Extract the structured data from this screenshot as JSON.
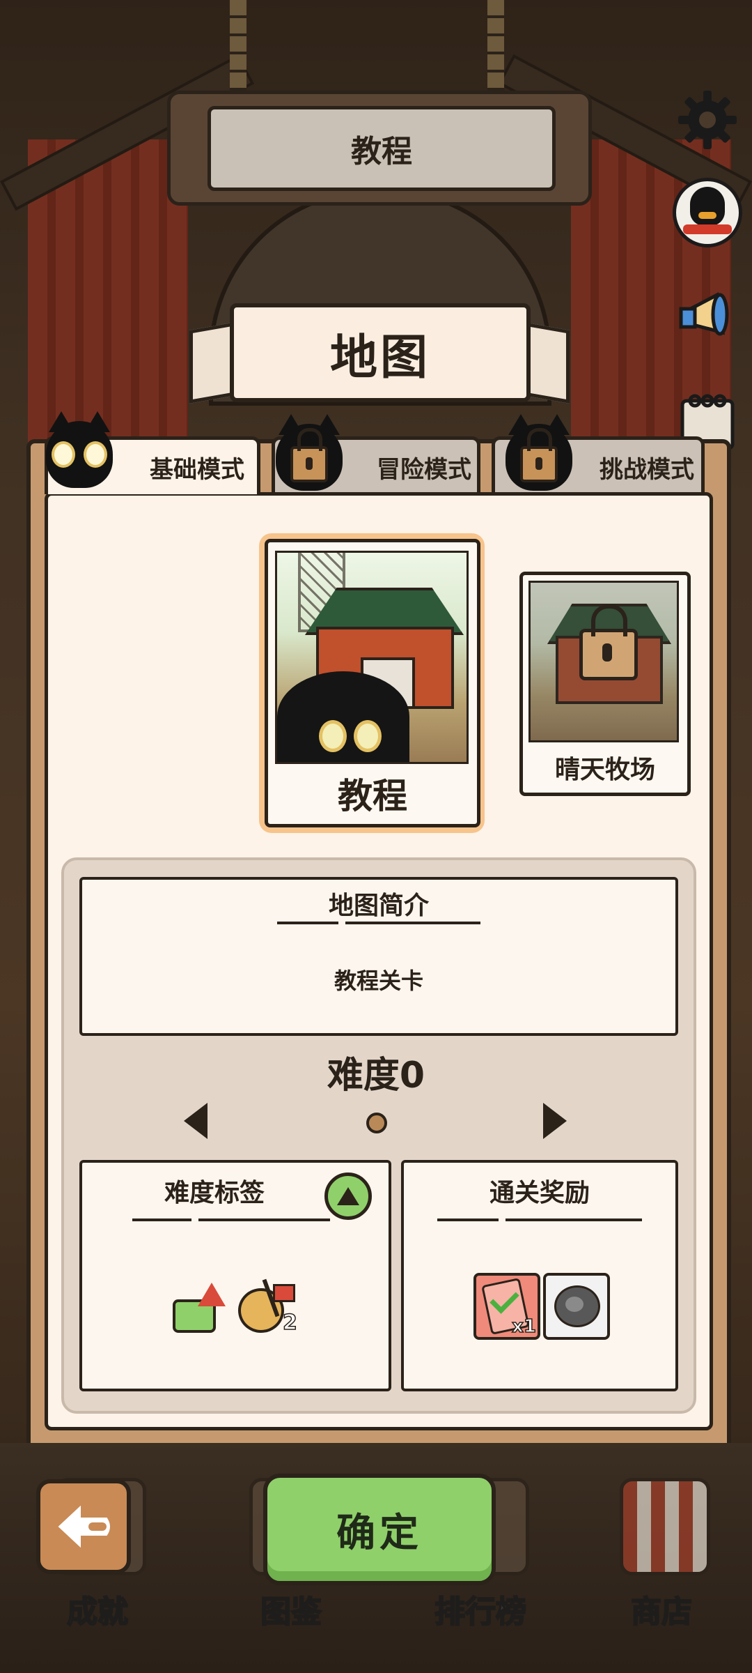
{
  "top_sign": {
    "title": "教程"
  },
  "map_banner": {
    "title": "地图"
  },
  "tabs": [
    {
      "label": "基础模式",
      "locked": false
    },
    {
      "label": "冒险模式",
      "locked": true
    },
    {
      "label": "挑战模式",
      "locked": true
    }
  ],
  "maps": [
    {
      "name": "教程",
      "selected": true,
      "locked": false
    },
    {
      "name": "晴天牧场",
      "selected": false,
      "locked": true
    }
  ],
  "map_info": {
    "intro_title": "地图简介",
    "intro_text": "教程关卡",
    "difficulty": "难度0"
  },
  "difficulty_tags": {
    "title": "难度标签",
    "badge_icon": "triangle-up-icon",
    "tag2_count": "2"
  },
  "rewards": {
    "title": "通关奖励",
    "item1_count": "x1"
  },
  "bottom_nav": [
    {
      "label": "成就"
    },
    {
      "label": "图鉴"
    },
    {
      "label": "排行榜"
    },
    {
      "label": "商店"
    }
  ],
  "confirm_label": "确定",
  "side_buttons": [
    "gear-icon",
    "penguin-icon",
    "megaphone-icon",
    "calendar-icon"
  ],
  "colors": {
    "accent_green": "#8fd06a",
    "panel_brown": "#c69a6e",
    "card_selected": "#f7c48c"
  }
}
